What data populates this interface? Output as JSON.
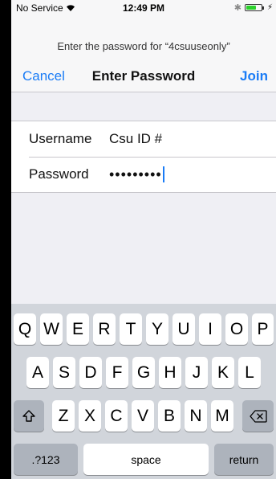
{
  "status_bar": {
    "carrier": "No Service",
    "time": "12:49 PM",
    "icons": [
      "wifi-icon",
      "bluetooth-icon",
      "battery-icon",
      "charging-icon"
    ]
  },
  "prompt": "Enter the password for “4csuuseonly”",
  "nav": {
    "cancel_label": "Cancel",
    "title": "Enter Password",
    "join_label": "Join"
  },
  "form": {
    "username_label": "Username",
    "username_value": "Csu ID #",
    "password_label": "Password",
    "password_value": "•••••••••"
  },
  "keyboard": {
    "row1": [
      "Q",
      "W",
      "E",
      "R",
      "T",
      "Y",
      "U",
      "I",
      "O",
      "P"
    ],
    "row2": [
      "A",
      "S",
      "D",
      "F",
      "G",
      "H",
      "J",
      "K",
      "L"
    ],
    "row3": [
      "Z",
      "X",
      "C",
      "V",
      "B",
      "N",
      "M"
    ],
    "numbers_label": ".?123",
    "space_label": "space",
    "return_label": "return"
  },
  "colors": {
    "accent": "#1a7cf6",
    "keyboard_bg": "#d1d5db",
    "battery": "#2bd12b"
  }
}
